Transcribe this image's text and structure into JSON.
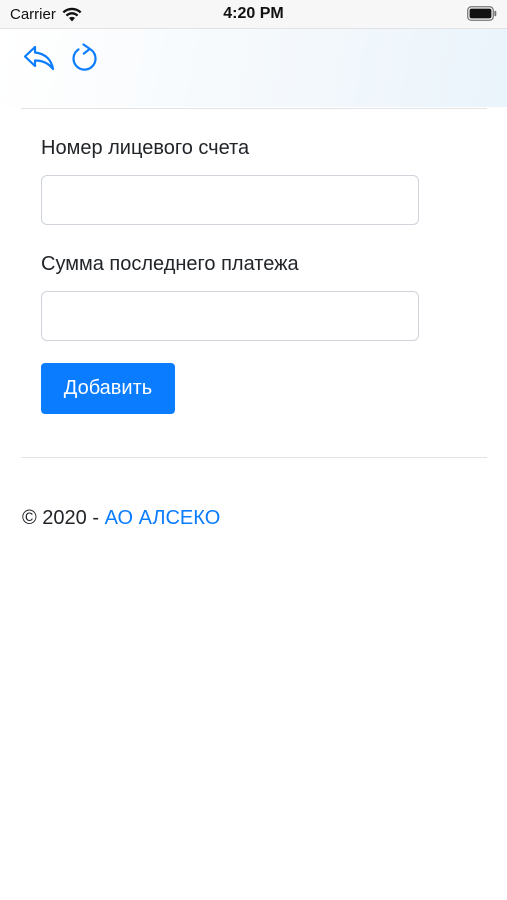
{
  "status_bar": {
    "carrier": "Carrier",
    "time": "4:20 PM",
    "icons": [
      "wifi-icon",
      "battery-icon"
    ]
  },
  "toolbar": {
    "icons": [
      "back-arrow-icon",
      "reload-icon"
    ]
  },
  "form": {
    "account_label": "Номер лицевого счета",
    "account_value": "",
    "payment_label": "Сумма последнего платежа",
    "payment_value": "",
    "submit_label": "Добавить"
  },
  "footer": {
    "copyright": "© 2020 - ",
    "company_link": "АО АЛСЕКО"
  },
  "colors": {
    "accent": "#0a7cff",
    "text": "#212529",
    "border": "#ced4da"
  }
}
